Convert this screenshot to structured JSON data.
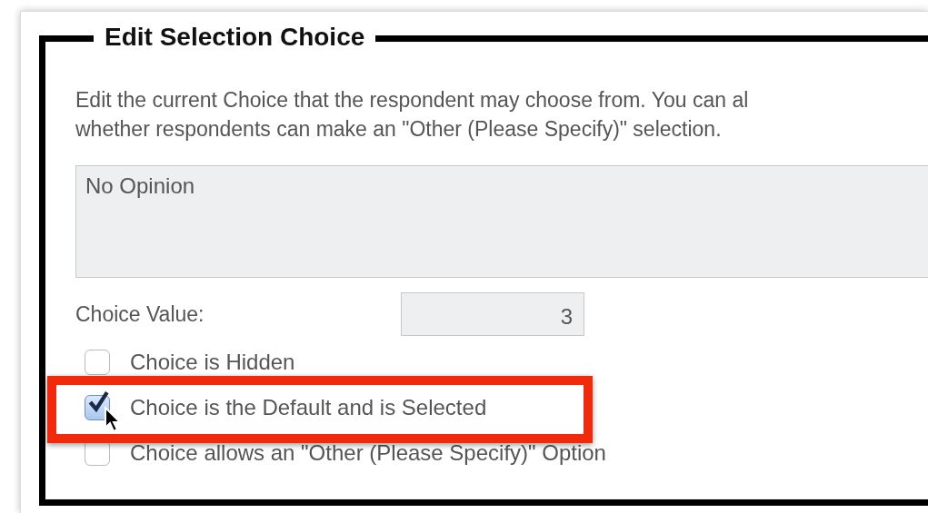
{
  "legend": "Edit Selection Choice",
  "description_lines": [
    "Edit the current Choice that the respondent may choose from. You can al",
    "whether respondents can make an \"Other (Please Specify)\" selection."
  ],
  "choice_text": {
    "value": "No Opinion"
  },
  "choice_value": {
    "label": "Choice Value:",
    "value": "3"
  },
  "options": [
    {
      "label": "Choice is Hidden",
      "checked": false,
      "highlighted": false
    },
    {
      "label": "Choice is the Default and is Selected",
      "checked": true,
      "highlighted": true
    },
    {
      "label": "Choice allows an \"Other (Please Specify)\" Option",
      "checked": false,
      "highlighted": false
    }
  ]
}
